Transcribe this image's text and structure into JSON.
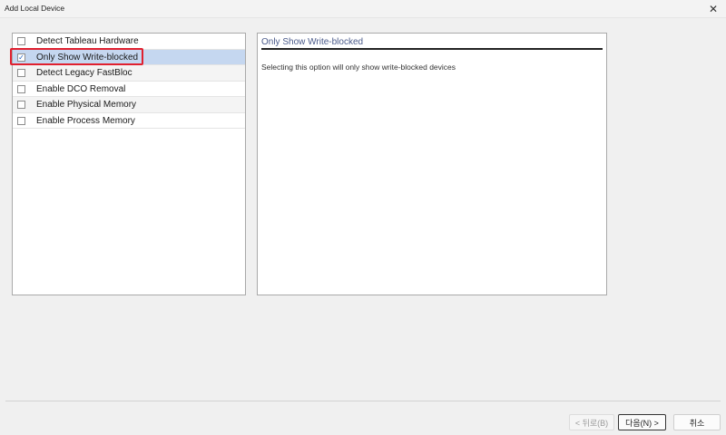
{
  "window": {
    "title": "Add Local Device",
    "close_glyph": "✕"
  },
  "options": [
    {
      "label": "Detect Tableau Hardware",
      "checked": false
    },
    {
      "label": "Only Show Write-blocked",
      "checked": true
    },
    {
      "label": "Detect Legacy FastBloc",
      "checked": false
    },
    {
      "label": "Enable DCO Removal",
      "checked": false
    },
    {
      "label": "Enable Physical Memory",
      "checked": false
    },
    {
      "label": "Enable Process Memory",
      "checked": false
    }
  ],
  "check_glyph": "☑",
  "description": {
    "title": "Only Show Write-blocked",
    "text": "Selecting this option will only show write-blocked devices"
  },
  "buttons": {
    "back": "< 뒤로(B)",
    "next": "다음(N) >",
    "cancel": "취소"
  },
  "colors": {
    "selection": "#c5d7f0",
    "highlight": "#e0202f"
  }
}
